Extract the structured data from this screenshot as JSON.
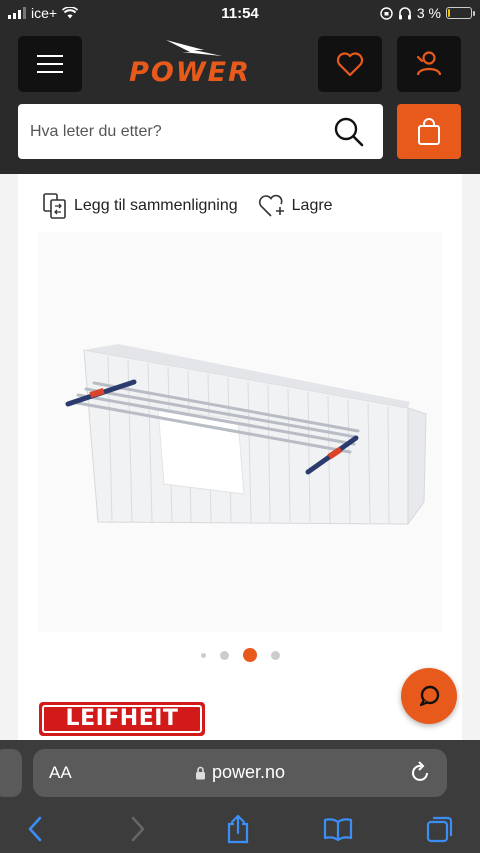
{
  "status_bar": {
    "carrier": "ice+",
    "time": "11:54",
    "battery": "3 %",
    "battery_level": 0.03
  },
  "header": {
    "logo_text": "POWER",
    "search": {
      "placeholder": "Hva leter du etter?"
    },
    "icons": {
      "menu": "hamburger-icon",
      "wishlist": "heart-icon",
      "account": "user-icon",
      "search": "search-icon",
      "cart": "shopping-bag-icon"
    }
  },
  "product": {
    "actions": {
      "compare_label": "Legg til sammenligning",
      "save_label": "Lagre"
    },
    "gallery": {
      "image_count": 4,
      "active_index": 2
    },
    "brand": "LEIFHEIT"
  },
  "browser": {
    "aa_label": "AA",
    "url": "power.no"
  },
  "colors": {
    "accent": "#e85a1b",
    "header_bg": "#2a2a2a",
    "brand_red": "#d31a1a"
  }
}
